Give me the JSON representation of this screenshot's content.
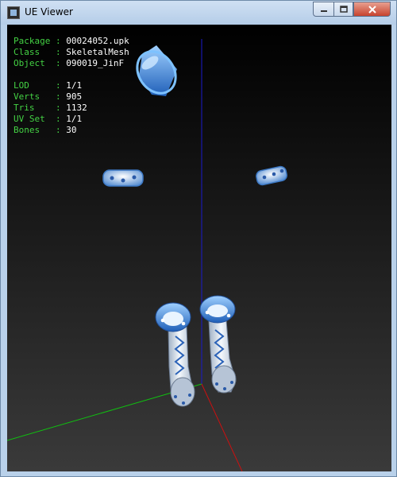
{
  "window": {
    "title": "UE Viewer",
    "controls": {
      "minimize_icon": "minimize-icon",
      "maximize_icon": "maximize-icon",
      "close_icon": "close-icon"
    }
  },
  "info": {
    "package_label": "Package : ",
    "package_value": "00024052.upk",
    "class_label": "Class   : ",
    "class_value": "SkeletalMesh",
    "object_label": "Object  : ",
    "object_value": "090019_JinF",
    "lod_label": "LOD     : ",
    "lod_value": "1/1",
    "verts_label": "Verts   : ",
    "verts_value": "905",
    "tris_label": "Tris    : ",
    "tris_value": "1132",
    "uvset_label": "UV Set  : ",
    "uvset_value": "1/1",
    "bones_label": "Bones   : ",
    "bones_value": "30"
  },
  "colors": {
    "label_green": "#44d244",
    "axis_x": "#cc1010",
    "axis_y": "#10c010",
    "axis_z": "#1a1acc",
    "mesh_blue": "#3a8ee0"
  }
}
